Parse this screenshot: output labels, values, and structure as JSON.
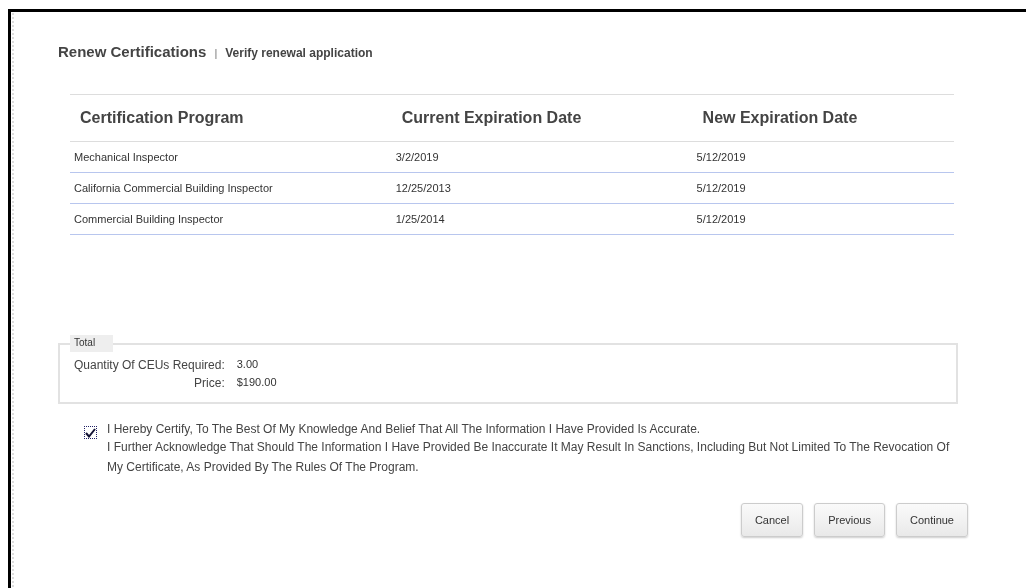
{
  "header": {
    "title": "Renew Certifications",
    "separator": "|",
    "subtitle": "Verify renewal application"
  },
  "table": {
    "columns": [
      "Certification Program",
      "Current Expiration Date",
      "New Expiration Date"
    ],
    "rows": [
      [
        "Mechanical Inspector",
        "3/2/2019",
        "5/12/2019"
      ],
      [
        "California Commercial Building Inspector",
        "12/25/2013",
        "5/12/2019"
      ],
      [
        "Commercial Building Inspector",
        "1/25/2014",
        "5/12/2019"
      ]
    ]
  },
  "total": {
    "legend": "Total",
    "items": [
      {
        "label": "Quantity Of CEUs Required:",
        "value": "3.00"
      },
      {
        "label": "Price:",
        "value": "$190.00"
      }
    ]
  },
  "certify": {
    "checked": true,
    "lines": [
      "I Hereby Certify, To The Best Of My Knowledge And Belief That All The Information I Have Provided Is Accurate.",
      "I Further Acknowledge That Should The Information I Have Provided Be Inaccurate It May Result In Sanctions, Including But Not Limited To The Revocation Of My Certificate, As Provided By The Rules Of The Program."
    ]
  },
  "buttons": [
    "Cancel",
    "Previous",
    "Continue"
  ]
}
